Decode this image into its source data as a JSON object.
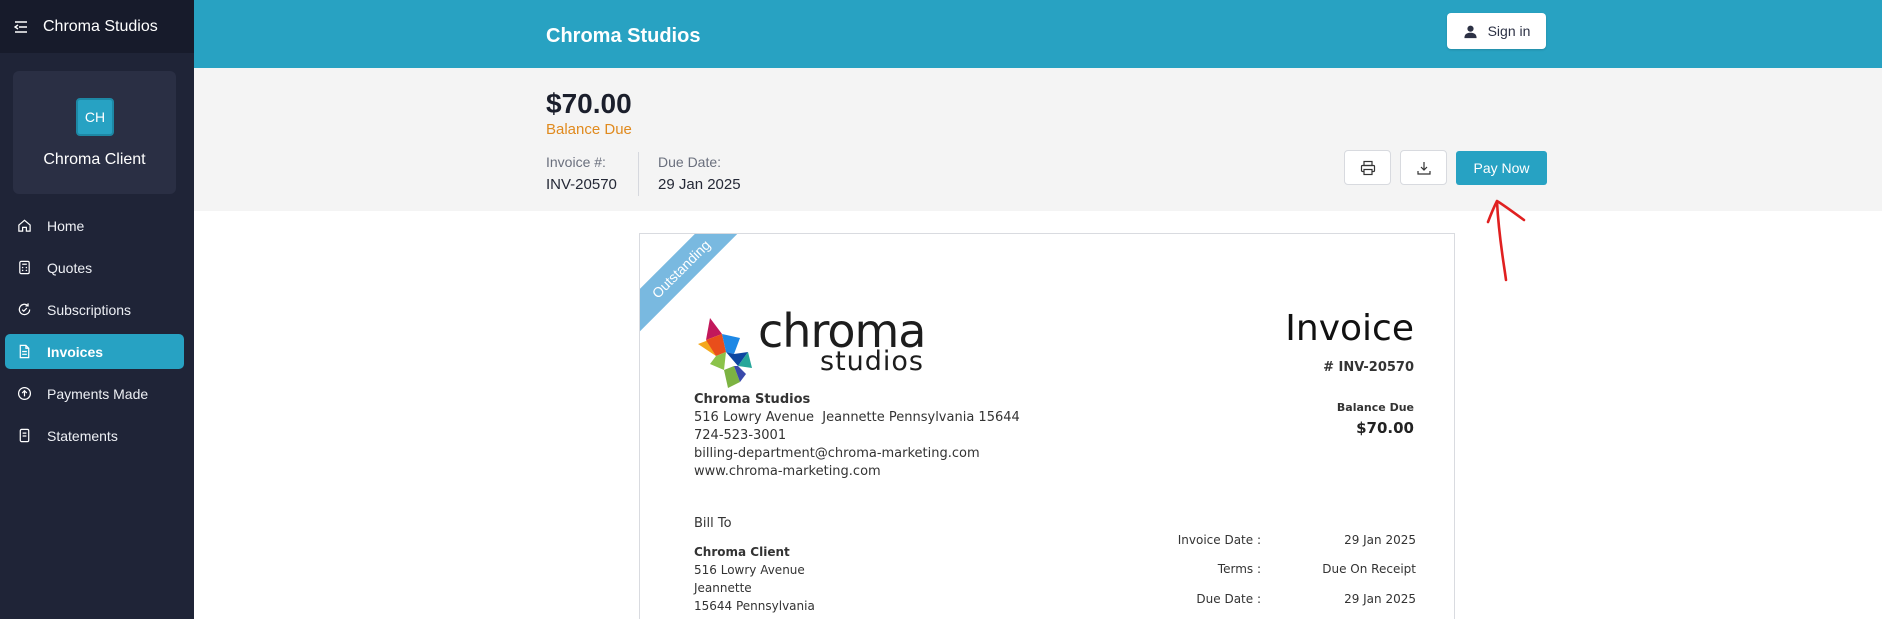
{
  "sidebar": {
    "app_title": "Chroma Studios",
    "avatar_initials": "CH",
    "client_name": "Chroma Client",
    "items": [
      {
        "label": "Home",
        "icon": "home-icon"
      },
      {
        "label": "Quotes",
        "icon": "calculator-icon"
      },
      {
        "label": "Subscriptions",
        "icon": "refresh-icon"
      },
      {
        "label": "Invoices",
        "icon": "document-icon",
        "active": true
      },
      {
        "label": "Payments Made",
        "icon": "upload-icon"
      },
      {
        "label": "Statements",
        "icon": "statement-icon"
      }
    ]
  },
  "header": {
    "brand": "Chroma Studios",
    "sign_in_label": "Sign in"
  },
  "summary": {
    "amount": "$70.00",
    "balance_label": "Balance Due",
    "invoice_no_label": "Invoice #:",
    "invoice_no": "INV-20570",
    "due_date_label": "Due Date:",
    "due_date": "29 Jan 2025",
    "pay_now_label": "Pay Now"
  },
  "invoice": {
    "ribbon": "Outstanding",
    "logo_text_main": "chroma",
    "logo_text_sub": "studios",
    "title": "Invoice",
    "number": "# INV-20570",
    "balance_due_label": "Balance Due",
    "balance_due": "$70.00",
    "company": {
      "name": "Chroma Studios",
      "address": "516 Lowry Avenue  Jeannette Pennsylvania 15644",
      "phone": "724-523-3001",
      "email": "billing-department@chroma-marketing.com",
      "website": "www.chroma-marketing.com"
    },
    "bill_to_label": "Bill To",
    "bill_to": {
      "name": "Chroma Client",
      "line1": "516 Lowry Avenue",
      "line2": "Jeannette",
      "line3": "15644 Pennsylvania"
    },
    "details": [
      {
        "label": "Invoice Date :",
        "value": "29 Jan 2025"
      },
      {
        "label": "Terms :",
        "value": "Due On Receipt"
      },
      {
        "label": "Due Date :",
        "value": "29 Jan 2025"
      }
    ]
  },
  "colors": {
    "accent": "#27a2c3",
    "sidebar": "#1f2437",
    "balance_orange": "#e08a1e",
    "annotation_red": "#e02020"
  }
}
